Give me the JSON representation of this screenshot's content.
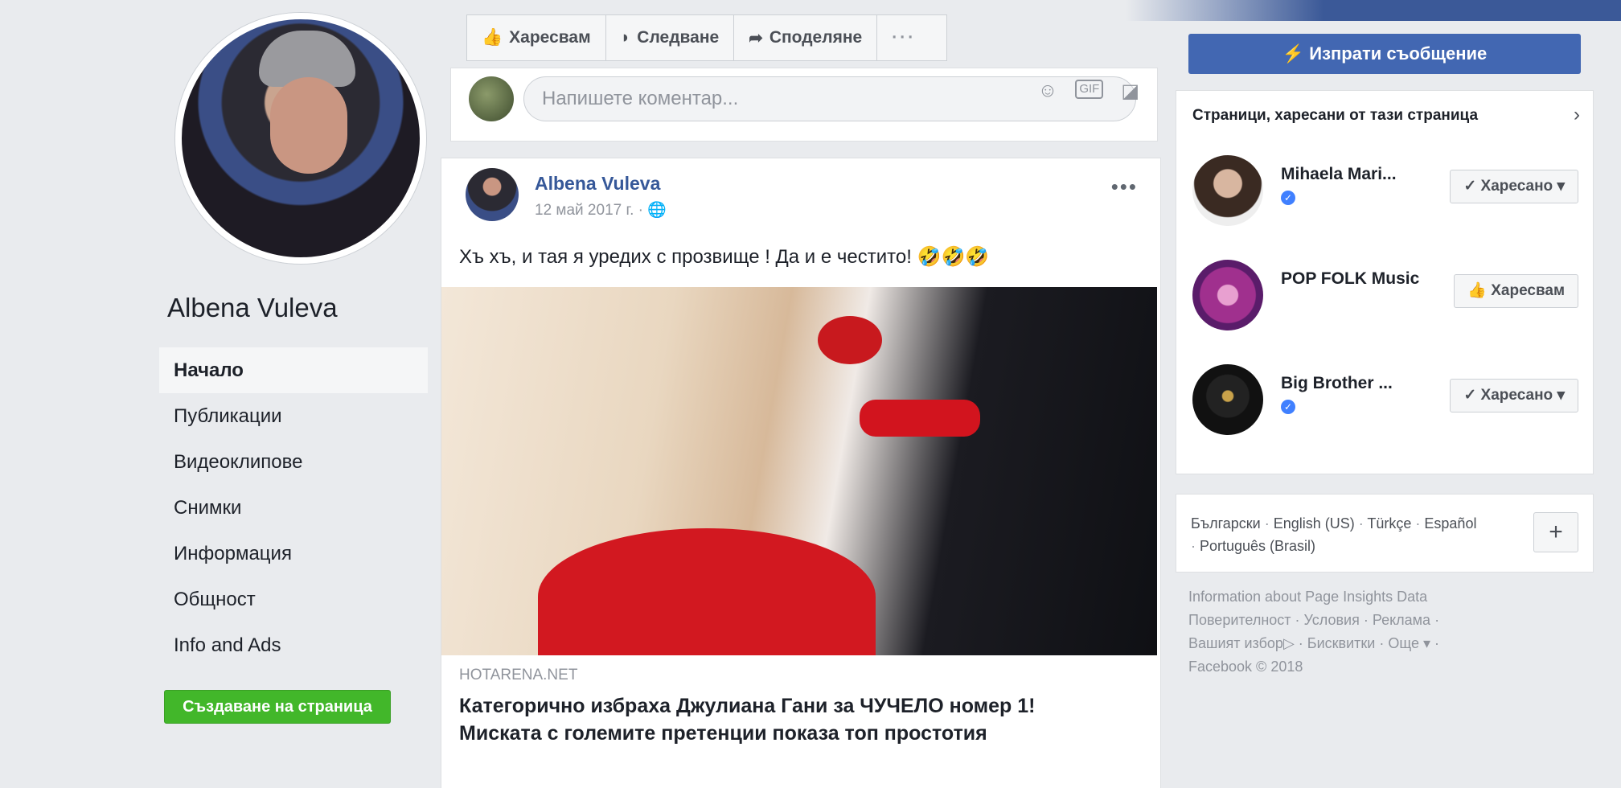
{
  "left": {
    "page_name": "Albena Vuleva",
    "nav": [
      "Начало",
      "Публикации",
      "Видеоклипове",
      "Снимки",
      "Информация",
      "Общност",
      "Info and Ads"
    ],
    "create_page": "Създаване на страница"
  },
  "actions": {
    "like": "Харесвам",
    "follow": "Следване",
    "share": "Споделяне",
    "more": "···"
  },
  "comment": {
    "placeholder": "Напишете коментар..."
  },
  "post": {
    "author": "Albena Vuleva",
    "date": "12 май 2017 г. ·",
    "text": "Хъ хъ, и тая я уредих с прозвище ! Да и е честито! 🤣🤣🤣",
    "link_domain": "HOTARENA.NET",
    "link_title": "Категорично избраха Джулиана Гани за ЧУЧЕЛО номер 1! Миската с големите претенции показа топ простотия"
  },
  "sidebar": {
    "message_button": "Изпрати съобщение",
    "liked_title": "Страници, харесани от тази страница",
    "liked_pages": [
      {
        "name": "Mihaela Mari...",
        "button": "Харесано",
        "verified": true
      },
      {
        "name": "POP FOLK Music",
        "button": "Харесвам",
        "verified": false
      },
      {
        "name": "Big Brother ...",
        "button": "Харесано",
        "verified": true
      }
    ],
    "languages": {
      "bg": "Български",
      "en": "English (US)",
      "tr": "Türkçe",
      "es": "Español",
      "pt": "Português (Brasil)"
    },
    "footer": {
      "insights": "Information about Page Insights Data",
      "privacy": "Поверителност",
      "terms": "Условия",
      "ads": "Реклама",
      "choices": "Вашият избор",
      "cookies": "Бисквитки",
      "more": "Още",
      "copyright": "Facebook © 2018"
    }
  },
  "colors": {
    "brand": "#4267b2",
    "link": "#365899",
    "create": "#42b72a"
  }
}
